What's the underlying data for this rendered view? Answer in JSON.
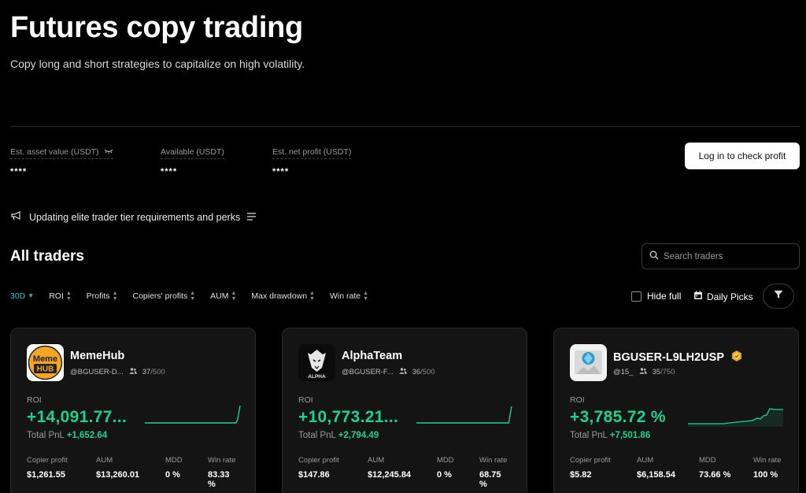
{
  "hero": {
    "title": "Futures copy trading",
    "subtitle": "Copy long and short strategies to capitalize on high volatility."
  },
  "stats": [
    {
      "label": "Est. asset value (USDT)",
      "value": "****",
      "icon": "eye-closed-icon"
    },
    {
      "label": "Available (USDT)",
      "value": "****"
    },
    {
      "label": "Est. net profit (USDT)",
      "value": "****"
    }
  ],
  "login_label": "Log in to check profit",
  "notice": {
    "text": "Updating elite trader tier requirements and perks",
    "icon": "megaphone-icon"
  },
  "section_title": "All traders",
  "search": {
    "placeholder": "Search traders"
  },
  "filters": [
    "30D",
    "ROI",
    "Profits",
    "Copiers' profits",
    "AUM",
    "Max drawdown",
    "Win rate"
  ],
  "hide_full": "Hide full",
  "daily_picks": "Daily Picks",
  "accent": "#1fd18f",
  "cards": [
    {
      "name": "MemeHub",
      "handle": "@BGUSER-D...",
      "copiers": "37",
      "max": "/500",
      "roi_label": "ROI",
      "roi": "+14,091.77...",
      "pnl_label": "Total PnL",
      "pnl": "+1,652.64",
      "metrics": [
        {
          "label": "Copier profit",
          "value": "$1,261.55"
        },
        {
          "label": "AUM",
          "value": "$13,260.01"
        },
        {
          "label": "MDD",
          "value": "0 %"
        },
        {
          "label": "Win rate",
          "value": "83.33 %"
        }
      ]
    },
    {
      "name": "AlphaTeam",
      "handle": "@BGUSER-F...",
      "copiers": "36",
      "max": "/500",
      "roi_label": "ROI",
      "roi": "+10,773.21...",
      "pnl_label": "Total PnL",
      "pnl": "+2,794.49",
      "metrics": [
        {
          "label": "Copier profit",
          "value": "$147.86"
        },
        {
          "label": "AUM",
          "value": "$12,245.84"
        },
        {
          "label": "MDD",
          "value": "0 %"
        },
        {
          "label": "Win rate",
          "value": "68.75 %"
        }
      ]
    },
    {
      "name": "BGUSER-L9LH2USP",
      "handle": "@15_",
      "copiers": "35",
      "max": "/750",
      "roi_label": "ROI",
      "roi": "+3,785.72 %",
      "pnl_label": "Total PnL",
      "pnl": "+7,501.86",
      "metrics": [
        {
          "label": "Copier profit",
          "value": "$5.82"
        },
        {
          "label": "AUM",
          "value": "$6,158.54"
        },
        {
          "label": "MDD",
          "value": "73.66 %"
        },
        {
          "label": "Win rate",
          "value": "100 %"
        }
      ]
    }
  ]
}
